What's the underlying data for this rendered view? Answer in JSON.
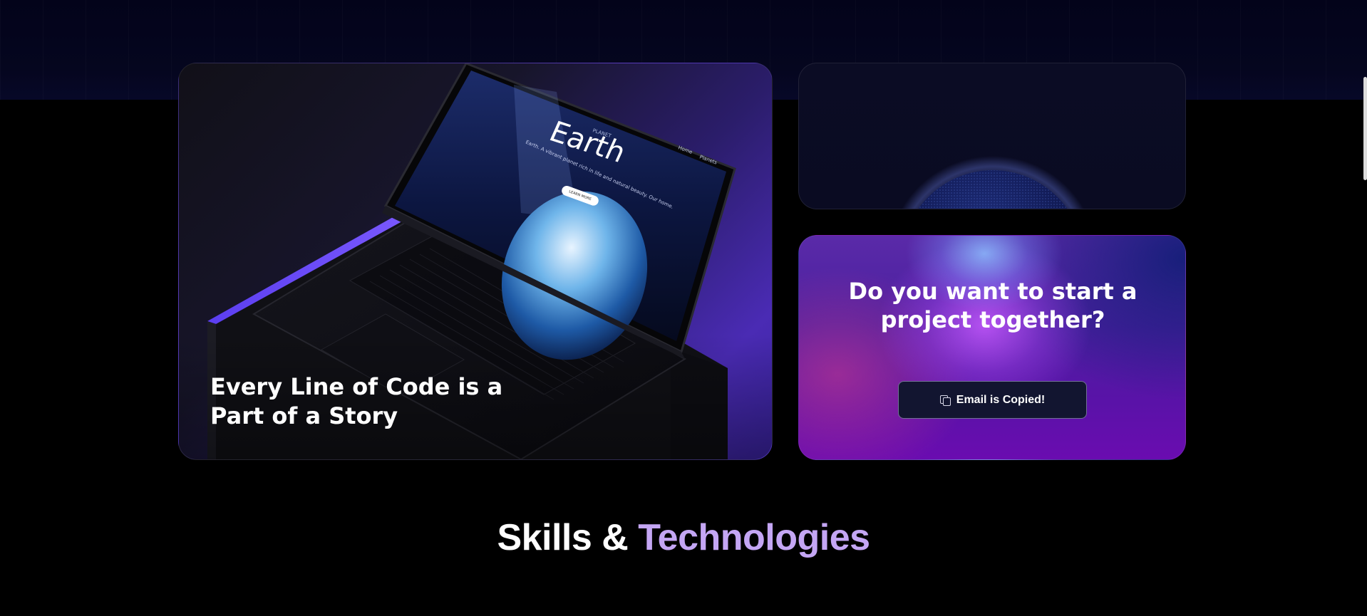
{
  "main_card": {
    "headline": "Every Line of Code is a Part of a Story",
    "screen": {
      "kicker": "PLANET",
      "title": "Earth",
      "subtitle": "Earth. A vibrant planet rich in life and natural beauty. Our home.",
      "button": "LEARN MORE",
      "nav": [
        "Home",
        "Planets"
      ]
    }
  },
  "cta_card": {
    "title": "Do you want to start a project together?",
    "button_label": "Email is Copied!"
  },
  "skills": {
    "title_plain": "Skills & ",
    "title_accent": "Technologies"
  },
  "colors": {
    "background": "#000000",
    "accent_text": "#c4a6f4",
    "cta_button_bg": "#121530"
  }
}
